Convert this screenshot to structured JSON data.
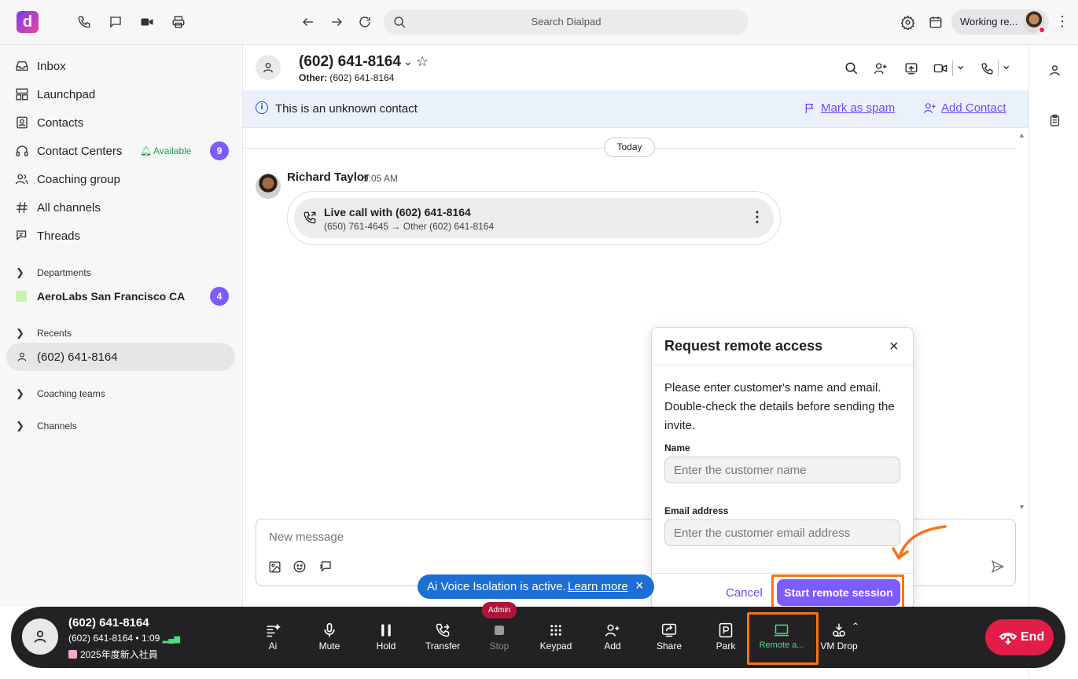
{
  "topbar": {
    "logo_letter": "d",
    "search_placeholder": "Search Dialpad",
    "status_label": "Working re..."
  },
  "sidebar": {
    "items": [
      {
        "label": "Inbox",
        "icon": "inbox-icon"
      },
      {
        "label": "Launchpad",
        "icon": "launchpad-icon"
      },
      {
        "label": "Contacts",
        "icon": "contacts-icon"
      },
      {
        "label": "Contact Centers",
        "icon": "headset-icon",
        "status": "Available",
        "badge": "9"
      },
      {
        "label": "Coaching group",
        "icon": "group-icon"
      },
      {
        "label": "All channels",
        "icon": "hash-icon"
      },
      {
        "label": "Threads",
        "icon": "threads-icon"
      }
    ],
    "departments_label": "Departments",
    "department": {
      "label": "AeroLabs San Francisco CA",
      "badge": "4"
    },
    "recents_label": "Recents",
    "recent_item": "(602) 641-8164",
    "coaching_teams_label": "Coaching teams",
    "channels_label": "Channels"
  },
  "header": {
    "title": "(602) 641-8164",
    "sub_label": "Other:",
    "sub_value": "(602) 641-8164"
  },
  "banner": {
    "text": "This is an unknown contact",
    "spam_label": "Mark as spam",
    "add_label": "Add Contact"
  },
  "feed": {
    "date_chip": "Today",
    "message": {
      "sender": "Richard Taylor",
      "time": "9:05 AM",
      "call_title": "Live call with (602) 641-8164",
      "call_detail": "(650) 761-4645 → Other (602) 641-8164"
    }
  },
  "composer": {
    "placeholder": "New message"
  },
  "modal": {
    "title": "Request remote access",
    "body": "Please enter customer's name and email. Double-check the details before sending the invite.",
    "name_label": "Name",
    "name_placeholder": "Enter the customer name",
    "email_label": "Email address",
    "email_placeholder": "Enter the customer email address",
    "cancel_label": "Cancel",
    "start_label": "Start remote session"
  },
  "toast": {
    "text": "Ai Voice Isolation is active.",
    "link": "Learn more"
  },
  "callbar": {
    "number": "(602) 641-8164",
    "sub_number": "(602) 641-8164",
    "duration": "1:09",
    "tag": "2025年度新入社員",
    "admin_badge": "Admin",
    "buttons": [
      {
        "label": "Ai",
        "icon": "ai-icon"
      },
      {
        "label": "Mute",
        "icon": "mic-icon"
      },
      {
        "label": "Hold",
        "icon": "pause-icon"
      },
      {
        "label": "Transfer",
        "icon": "transfer-icon"
      },
      {
        "label": "Stop",
        "icon": "stop-icon"
      },
      {
        "label": "Keypad",
        "icon": "keypad-icon"
      },
      {
        "label": "Add",
        "icon": "add-person-icon"
      },
      {
        "label": "Share",
        "icon": "share-icon"
      },
      {
        "label": "Park",
        "icon": "park-icon"
      },
      {
        "label": "Remote a...",
        "icon": "remote-access-icon"
      },
      {
        "label": "VM Drop",
        "icon": "vm-drop-icon"
      }
    ],
    "end_label": "End"
  },
  "colors": {
    "accent": "#6d4aff",
    "badge": "#7c5cff",
    "available": "#16a34a",
    "end": "#e11d48",
    "highlight": "#f97316",
    "toast": "#1d6fd6",
    "remote_active": "#4ade80"
  }
}
